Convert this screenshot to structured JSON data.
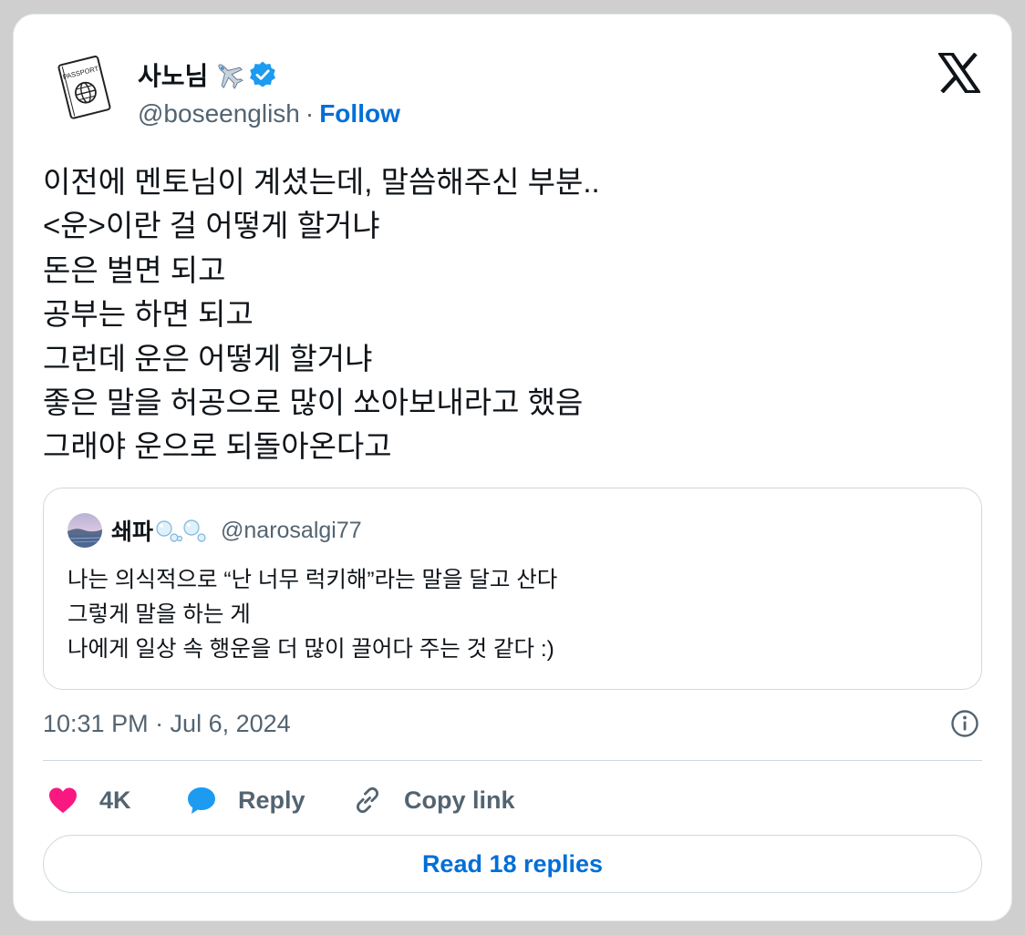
{
  "author": {
    "display_name": "사노님",
    "handle": "@boseenglish",
    "separator": "·",
    "follow_label": "Follow",
    "avatar_text": "PASSPORT"
  },
  "body_lines": [
    "이전에 멘토님이 계셨는데, 말씀해주신 부분..",
    "<운>이란 걸 어떻게 할거냐",
    "돈은 벌면 되고",
    "공부는 하면 되고",
    "그런데 운은 어떻게 할거냐",
    "좋은 말을 허공으로 많이 쏘아보내라고 했음",
    "그래야 운으로 되돌아온다고"
  ],
  "quoted": {
    "display_name": "쇄파",
    "handle": "@narosalgi77",
    "lines": [
      "나는 의식적으로 “난 너무 럭키해”라는 말을 달고 산다",
      "그렇게 말을 하는 게",
      "나에게 일상 속 행운을 더 많이 끌어다 주는 것 같다 :)"
    ]
  },
  "timestamp": "10:31 PM · Jul 6, 2024",
  "actions": {
    "like_count": "4K",
    "reply_label": "Reply",
    "copy_link_label": "Copy link"
  },
  "read_replies_label": "Read 18 replies",
  "colors": {
    "accent": "#006fd6",
    "verified": "#1d9bf0",
    "like": "#f91880",
    "reply_icon": "#1d9bf0",
    "muted": "#536471",
    "text": "#0f1419",
    "border": "#cfd9de"
  },
  "icons": {
    "brand": "x-logo-icon",
    "verified": "verified-badge-icon",
    "plane": "airplane-emoji-icon",
    "info": "info-icon",
    "like": "heart-icon",
    "reply": "speech-bubble-icon",
    "copy": "link-icon"
  }
}
